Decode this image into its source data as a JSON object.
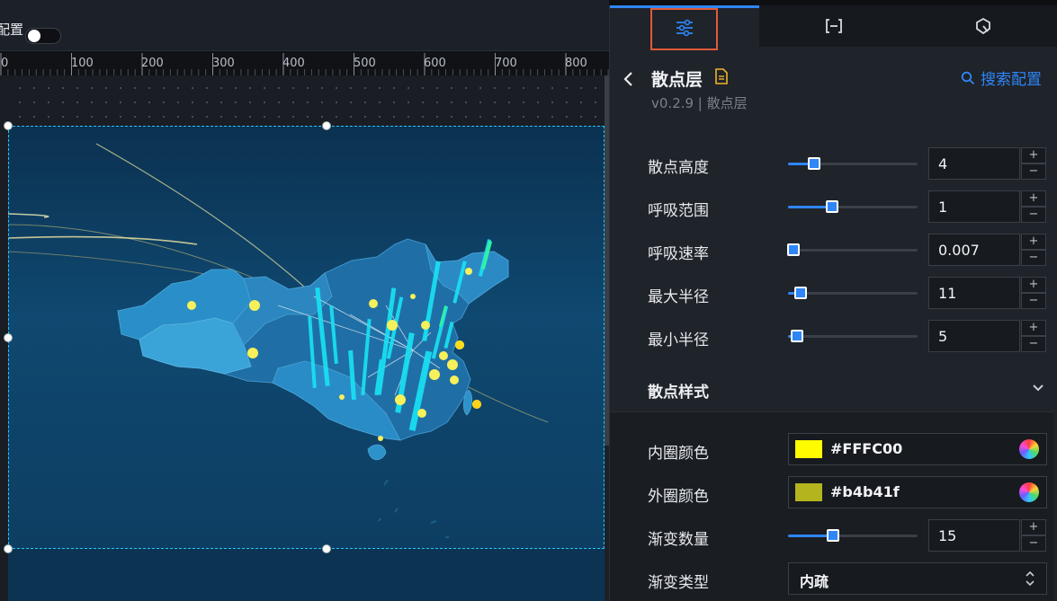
{
  "toolbar": {
    "label": "配置"
  },
  "ruler": {
    "labels": [
      "0",
      "100",
      "200",
      "300",
      "400",
      "500",
      "600",
      "700",
      "800"
    ]
  },
  "tabs": [
    {
      "name": "style",
      "icon": "sliders-icon"
    },
    {
      "name": "data",
      "icon": "bracket-icon"
    },
    {
      "name": "interaction",
      "icon": "cursor-icon"
    }
  ],
  "header": {
    "title": "散点层",
    "version": "v0.2.9 | 散点层",
    "search_label": "搜索配置"
  },
  "settings": {
    "sliders": [
      {
        "label": "散点高度",
        "value": "4",
        "fraction": 0.2
      },
      {
        "label": "呼吸范围",
        "value": "1",
        "fraction": 0.34
      },
      {
        "label": "呼吸速率",
        "value": "0.007",
        "fraction": 0.04
      },
      {
        "label": "最大半径",
        "value": "11",
        "fraction": 0.1
      },
      {
        "label": "最小半径",
        "value": "5",
        "fraction": 0.07
      }
    ],
    "section_title": "散点样式",
    "inner_color": {
      "label": "内圈颜色",
      "value": "#FFFC00",
      "swatch": "#FFFC00"
    },
    "outer_color": {
      "label": "外圈颜色",
      "value": "#b4b41f",
      "swatch": "#b4b41f"
    },
    "gradient_count": {
      "label": "渐变数量",
      "value": "15",
      "fraction": 0.35
    },
    "gradient_type": {
      "label": "渐变类型",
      "value": "内疏"
    }
  },
  "colors": {
    "accent": "#2f86f6",
    "highlight": "#e05a3a",
    "bar": "#19e3f5",
    "dot": "#f6f05a"
  }
}
